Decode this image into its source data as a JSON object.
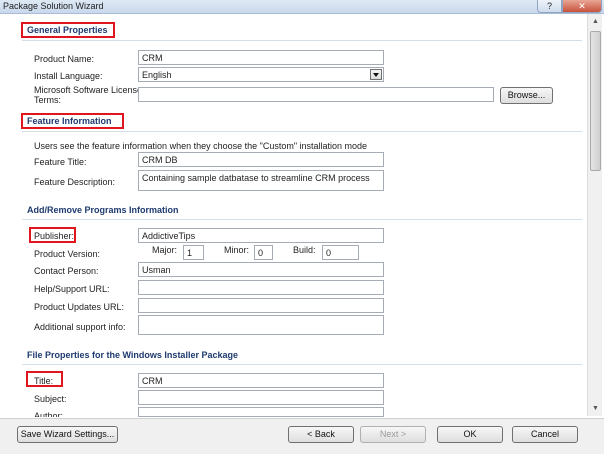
{
  "window": {
    "title": "Package Solution Wizard",
    "help_glyph": "?",
    "close_glyph": "✕"
  },
  "general": {
    "heading": "General Properties",
    "product_name_label": "Product Name:",
    "product_name": "CRM",
    "install_language_label": "Install Language:",
    "install_language": "English",
    "license_label_1": "Microsoft Software License",
    "license_label_2": "Terms:",
    "license_value": "",
    "browse_label": "Browse..."
  },
  "feature": {
    "heading": "Feature Information",
    "note": "Users see the feature information when they choose the \"Custom\" installation mode",
    "title_label": "Feature Title:",
    "title_value": "CRM DB",
    "description_label": "Feature Description:",
    "description_value": "Containing sample datbatase to streamline CRM process"
  },
  "programs": {
    "heading": "Add/Remove Programs Information",
    "publisher_label": "Publisher:",
    "publisher_value": "AddictiveTips",
    "version_label": "Product Version:",
    "major_label": "Major:",
    "major_value": "1",
    "minor_label": "Minor:",
    "minor_value": "0",
    "build_label": "Build:",
    "build_value": "0",
    "contact_label": "Contact Person:",
    "contact_value": "Usman",
    "help_url_label": "Help/Support URL:",
    "help_url_value": "",
    "updates_url_label": "Product Updates URL:",
    "updates_url_value": "",
    "support_info_label": "Additional support info:",
    "support_info_value": ""
  },
  "file_props": {
    "heading": "File Properties for the Windows Installer Package",
    "title_label": "Title:",
    "title_value": "CRM",
    "subject_label": "Subject:",
    "subject_value": "",
    "author_label": "Author:",
    "author_value": ""
  },
  "footer": {
    "save_label": "Save Wizard Settings...",
    "back_label": "< Back",
    "next_label": "Next >",
    "ok_label": "OK",
    "cancel_label": "Cancel"
  },
  "colors": {
    "highlight": "#e0161e",
    "heading_text": "#1e3a6e"
  }
}
